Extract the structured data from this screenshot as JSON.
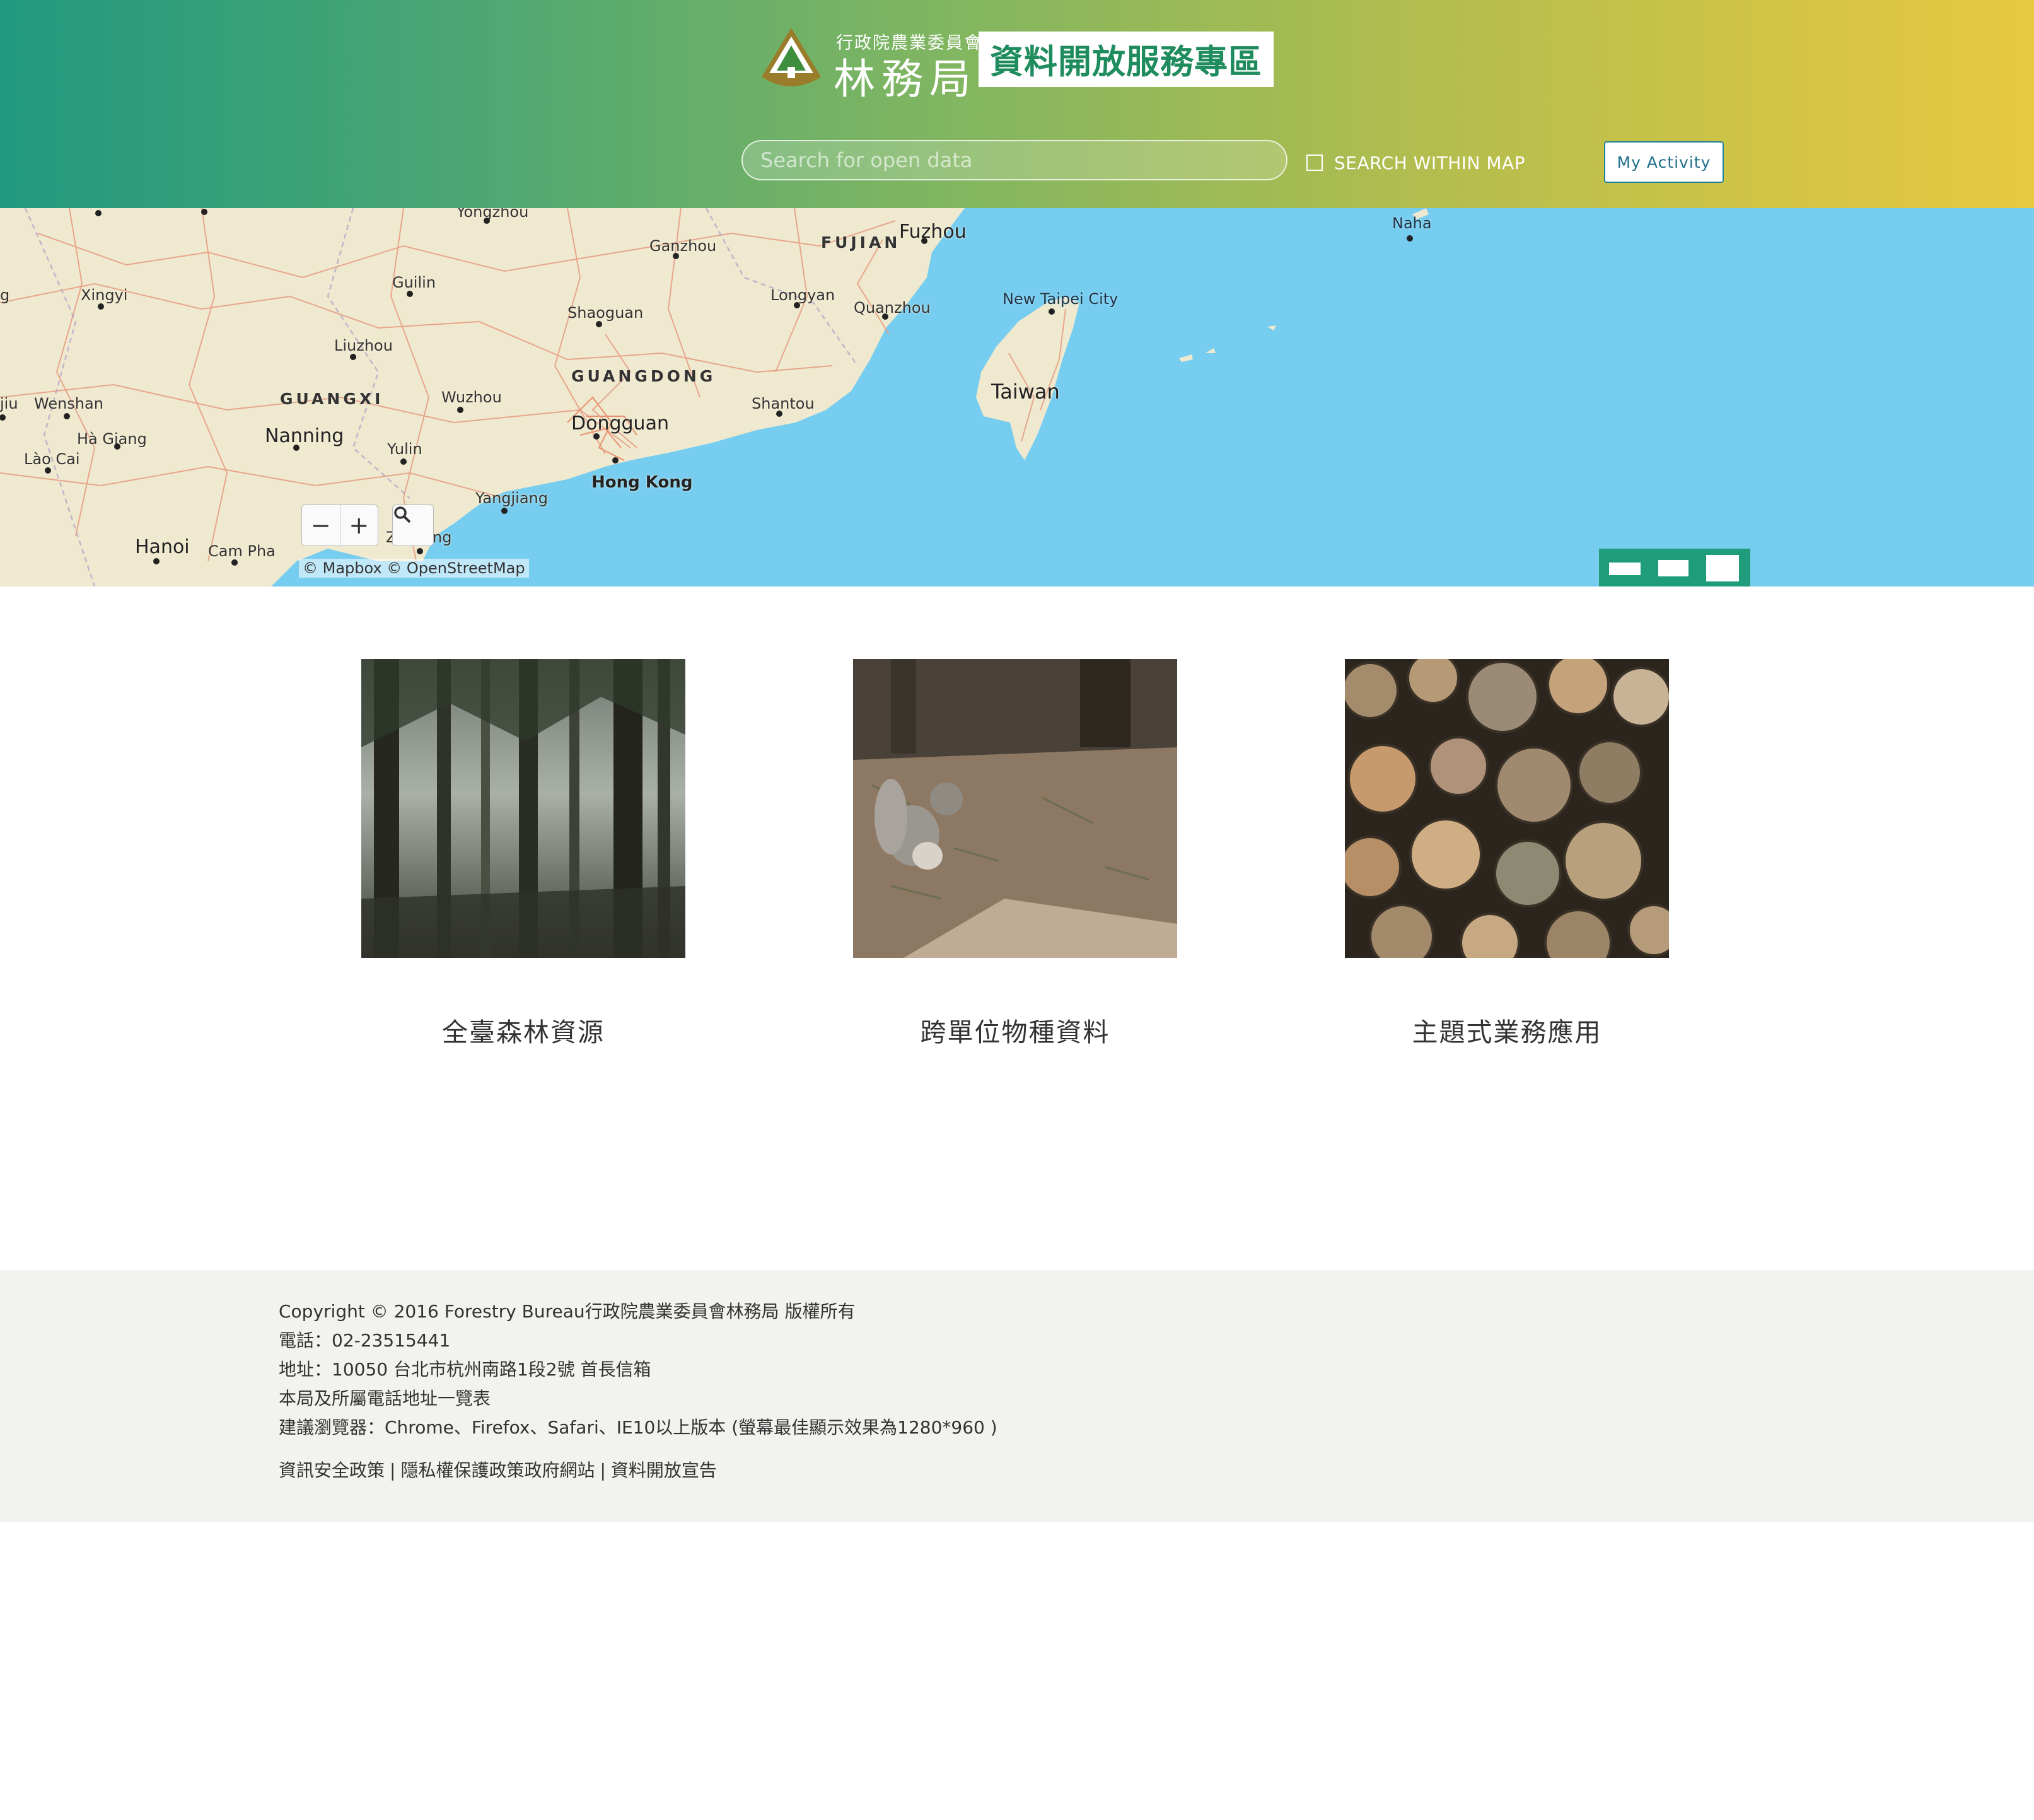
{
  "header": {
    "logo_small": "行政院農業委員會",
    "logo_big": "林務局",
    "site_title": "資料開放服務專區",
    "search_placeholder": "Search for open data",
    "search_within_map": "SEARCH WITHIN MAP",
    "my_activity": "My Activity"
  },
  "map": {
    "attribution": "© Mapbox © OpenStreetMap",
    "zoom_out": "−",
    "zoom_in": "+",
    "places": {
      "yongzhou": "Yongzhou",
      "ganzhou": "Ganzhou",
      "fujian": "FUJIAN",
      "fuzhou": "Fuzhou",
      "naha": "Naha",
      "xingyi": "Xingyi",
      "guilin": "Guilin",
      "shaoguan": "Shaoguan",
      "longyan": "Longyan",
      "quanzhou": "Quanzhou",
      "new_taipei": "New Taipei City",
      "liuzhou": "Liuzhou",
      "guangdong": "GUANGDONG",
      "taiwan": "Taiwan",
      "guangxi": "GUANGXI",
      "wuzhou": "Wuzhou",
      "wenshan": "Wenshan",
      "jiu": "jiu",
      "shantou": "Shantou",
      "dongguan": "Dongguan",
      "nanning": "Nanning",
      "ha_giang": "Hà Giang",
      "lao_cai": "Lào Cai",
      "yulin": "Yulin",
      "hong_kong": "Hong Kong",
      "yangjiang": "Yangjiang",
      "hanoi": "Hanoi",
      "cam_pha": "Cam Pha",
      "zhanjiang_frag": "Z",
      "zhanjiang_frag2": "ng",
      "edge_g": "g"
    }
  },
  "cards": [
    {
      "label": "全臺森林資源"
    },
    {
      "label": "跨單位物種資料"
    },
    {
      "label": "主題式業務應用"
    }
  ],
  "footer": {
    "copyright": "Copyright © 2016 Forestry Bureau行政院農業委員會林務局 版權所有",
    "phone": "電話：02-23515441",
    "address": "地址：10050 台北市杭州南路1段2號 首長信箱",
    "directory": "本局及所屬電話地址一覽表",
    "browser": "建議瀏覽器：Chrome、Firefox、Safari、IE10以上版本 (螢幕最佳顯示效果為1280*960 )",
    "links": [
      "資訊安全政策",
      "隱私權保護政策政府網站",
      "資料開放宣告"
    ]
  }
}
